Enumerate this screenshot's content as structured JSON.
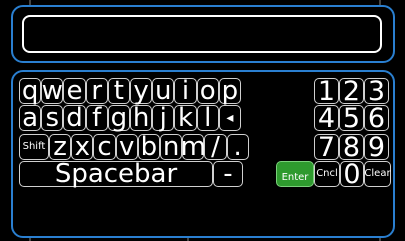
{
  "input": {
    "value": "",
    "placeholder": ""
  },
  "keyboard": {
    "rows": [
      [
        "q",
        "w",
        "e",
        "r",
        "t",
        "y",
        "u",
        "i",
        "o",
        "p"
      ],
      [
        "a",
        "s",
        "d",
        "f",
        "g",
        "h",
        "j",
        "k",
        "l"
      ],
      [
        "z",
        "x",
        "c",
        "v",
        "b",
        "n",
        "m",
        "/",
        "."
      ]
    ],
    "backspace_glyph": "◂",
    "shift_label": "Shift",
    "space_label": "Spacebar",
    "dash_label": "-",
    "enter_label": "Enter",
    "cancel_label": "Cncl",
    "clear_label": "Clear",
    "numpad": [
      [
        "1",
        "2",
        "3"
      ],
      [
        "4",
        "5",
        "6"
      ],
      [
        "7",
        "8",
        "9"
      ]
    ],
    "zero": "0",
    "colors": {
      "accent": "#2a7fd0",
      "enter": "#2e9a2e",
      "key_border": "#d0d0d0"
    }
  }
}
